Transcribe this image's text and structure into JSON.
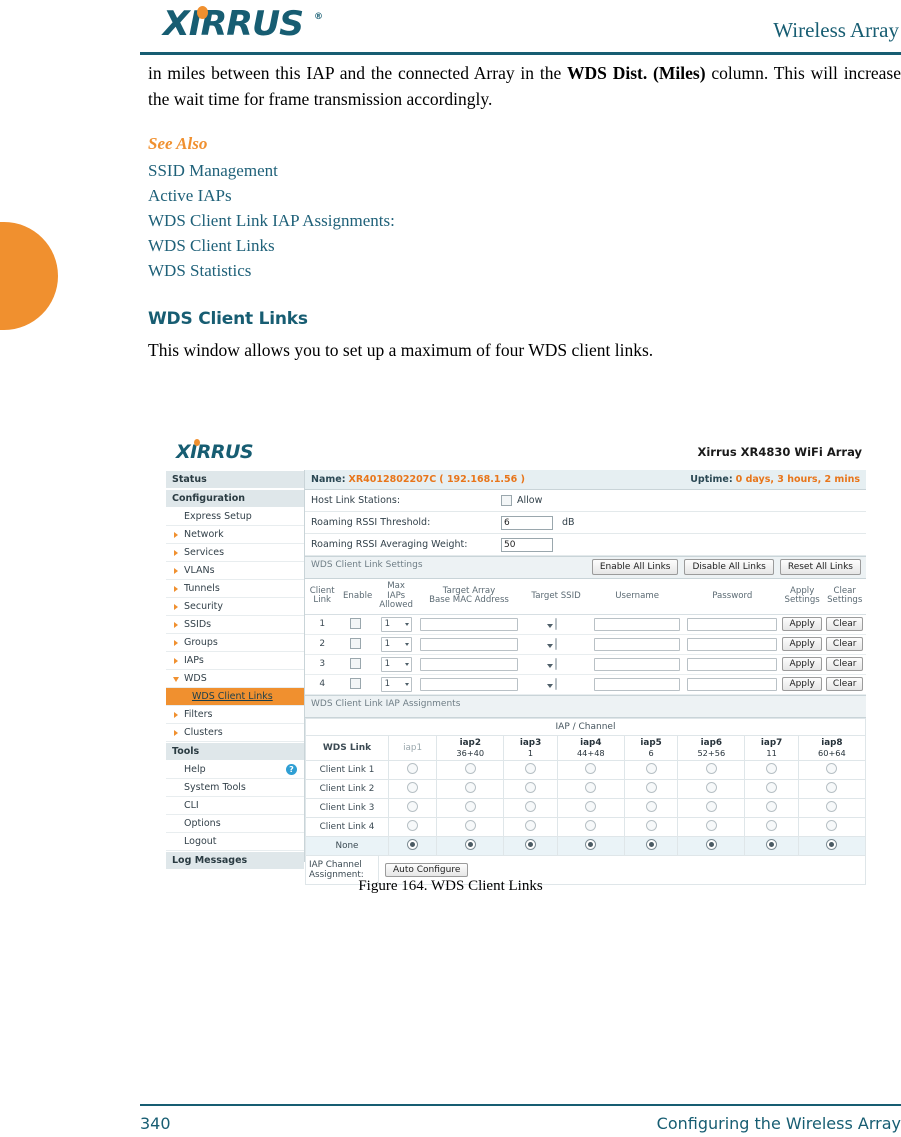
{
  "header": {
    "logo_text": "XIRRUS",
    "logo_tm": "®",
    "right_title": "Wireless Array"
  },
  "content": {
    "paragraph_1_pre": "in miles between this IAP and the connected Array in the ",
    "paragraph_1_bold": "WDS Dist. (Miles)",
    "paragraph_1_post": " column. This will increase the wait time for frame transmission accordingly.",
    "see_also_label": "See Also",
    "see_also_links": [
      "SSID Management",
      "Active IAPs",
      "WDS Client Link IAP Assignments:",
      "WDS Client Links",
      "WDS Statistics"
    ],
    "section_heading": "WDS Client Links",
    "section_paragraph": "This window allows you to set up a maximum of four WDS client links."
  },
  "app": {
    "logo_text": "XIRRUS",
    "title": "Xirrus XR4830 WiFi Array",
    "info_bar": {
      "name_label": "Name:",
      "name_value": "XR4012802207C",
      "ip_value": "( 192.168.1.56 )",
      "uptime_label": "Uptime:",
      "uptime_value": "0 days, 3 hours, 2 mins"
    },
    "sidebar": [
      {
        "label": "Status",
        "type": "group"
      },
      {
        "label": "Configuration",
        "type": "group"
      },
      {
        "label": "Express Setup",
        "type": "item",
        "arrow": "none"
      },
      {
        "label": "Network",
        "type": "item",
        "arrow": "right"
      },
      {
        "label": "Services",
        "type": "item",
        "arrow": "right"
      },
      {
        "label": "VLANs",
        "type": "item",
        "arrow": "right"
      },
      {
        "label": "Tunnels",
        "type": "item",
        "arrow": "right"
      },
      {
        "label": "Security",
        "type": "item",
        "arrow": "right"
      },
      {
        "label": "SSIDs",
        "type": "item",
        "arrow": "right"
      },
      {
        "label": "Groups",
        "type": "item",
        "arrow": "right"
      },
      {
        "label": "IAPs",
        "type": "item",
        "arrow": "right"
      },
      {
        "label": "WDS",
        "type": "item",
        "arrow": "down"
      },
      {
        "label": "WDS Client Links",
        "type": "sub",
        "active": true
      },
      {
        "label": "Filters",
        "type": "item",
        "arrow": "right"
      },
      {
        "label": "Clusters",
        "type": "item",
        "arrow": "right"
      },
      {
        "label": "Tools",
        "type": "group"
      },
      {
        "label": "Help",
        "type": "item",
        "arrow": "none",
        "icon": "help-icon"
      },
      {
        "label": "System Tools",
        "type": "item",
        "arrow": "none"
      },
      {
        "label": "CLI",
        "type": "item",
        "arrow": "none"
      },
      {
        "label": "Options",
        "type": "item",
        "arrow": "none"
      },
      {
        "label": "Logout",
        "type": "item",
        "arrow": "none"
      },
      {
        "label": "Log Messages",
        "type": "group"
      }
    ],
    "form": {
      "host_link_label": "Host Link Stations:",
      "host_link_checkbox_label": "Allow",
      "rssi_threshold_label": "Roaming RSSI Threshold:",
      "rssi_threshold_value": "6",
      "rssi_threshold_unit": "dB",
      "rssi_weight_label": "Roaming RSSI Averaging Weight:",
      "rssi_weight_value": "50"
    },
    "settings": {
      "strip_title": "WDS Client Link Settings",
      "enable_all": "Enable All Links",
      "disable_all": "Disable All Links",
      "reset_all": "Reset All Links",
      "headers": [
        "Client\nLink",
        "Enable",
        "Max\nIAPs\nAllowed",
        "Target Array\nBase MAC Address",
        "Target SSID",
        "Username",
        "Password",
        "Apply\nSettings",
        "Clear\nSettings"
      ],
      "header_parts": {
        "client_link": [
          "Client",
          "Link"
        ],
        "enable": "Enable",
        "max_iaps": [
          "Max",
          "IAPs",
          "Allowed"
        ],
        "target_mac": [
          "Target Array",
          "Base MAC Address"
        ],
        "target_ssid": "Target SSID",
        "username": "Username",
        "password": "Password",
        "apply_settings": [
          "Apply",
          "Settings"
        ],
        "clear_settings": [
          "Clear",
          "Settings"
        ]
      },
      "rows": [
        {
          "link": "1",
          "enabled": false,
          "max_iaps": "1",
          "mac": "",
          "ssid": "",
          "username": "",
          "password": "",
          "apply": "Apply",
          "clear": "Clear"
        },
        {
          "link": "2",
          "enabled": false,
          "max_iaps": "1",
          "mac": "",
          "ssid": "",
          "username": "",
          "password": "",
          "apply": "Apply",
          "clear": "Clear"
        },
        {
          "link": "3",
          "enabled": false,
          "max_iaps": "1",
          "mac": "",
          "ssid": "",
          "username": "",
          "password": "",
          "apply": "Apply",
          "clear": "Clear"
        },
        {
          "link": "4",
          "enabled": false,
          "max_iaps": "1",
          "mac": "",
          "ssid": "",
          "username": "",
          "password": "",
          "apply": "Apply",
          "clear": "Clear"
        }
      ]
    },
    "assignments": {
      "strip_title": "WDS Client Link IAP Assignments",
      "table_title": "IAP / Channel",
      "corner_label": "WDS Link",
      "columns": [
        {
          "name": "iap1",
          "channel": "",
          "dim": true
        },
        {
          "name": "iap2",
          "channel": "36+40",
          "dim": false
        },
        {
          "name": "iap3",
          "channel": "1",
          "dim": false
        },
        {
          "name": "iap4",
          "channel": "44+48",
          "dim": false
        },
        {
          "name": "iap5",
          "channel": "6",
          "dim": false
        },
        {
          "name": "iap6",
          "channel": "52+56",
          "dim": false
        },
        {
          "name": "iap7",
          "channel": "11",
          "dim": false
        },
        {
          "name": "iap8",
          "channel": "60+64",
          "dim": false
        }
      ],
      "rows": [
        {
          "label": "Client Link 1",
          "selected": []
        },
        {
          "label": "Client Link 2",
          "selected": []
        },
        {
          "label": "Client Link 3",
          "selected": []
        },
        {
          "label": "Client Link 4",
          "selected": []
        },
        {
          "label": "None",
          "selected": [
            0,
            1,
            2,
            3,
            4,
            5,
            6,
            7
          ]
        }
      ],
      "channel_assignment_label": [
        "IAP Channel",
        "Assignment:"
      ],
      "auto_configure_button": "Auto Configure"
    }
  },
  "caption": "Figure 164. WDS Client Links",
  "footer": {
    "page_number": "340",
    "chapter": "Configuring the Wireless Array"
  },
  "colors": {
    "brand_teal": "#175d72",
    "accent_orange": "#f0902f",
    "link_teal": "#1f6179"
  }
}
